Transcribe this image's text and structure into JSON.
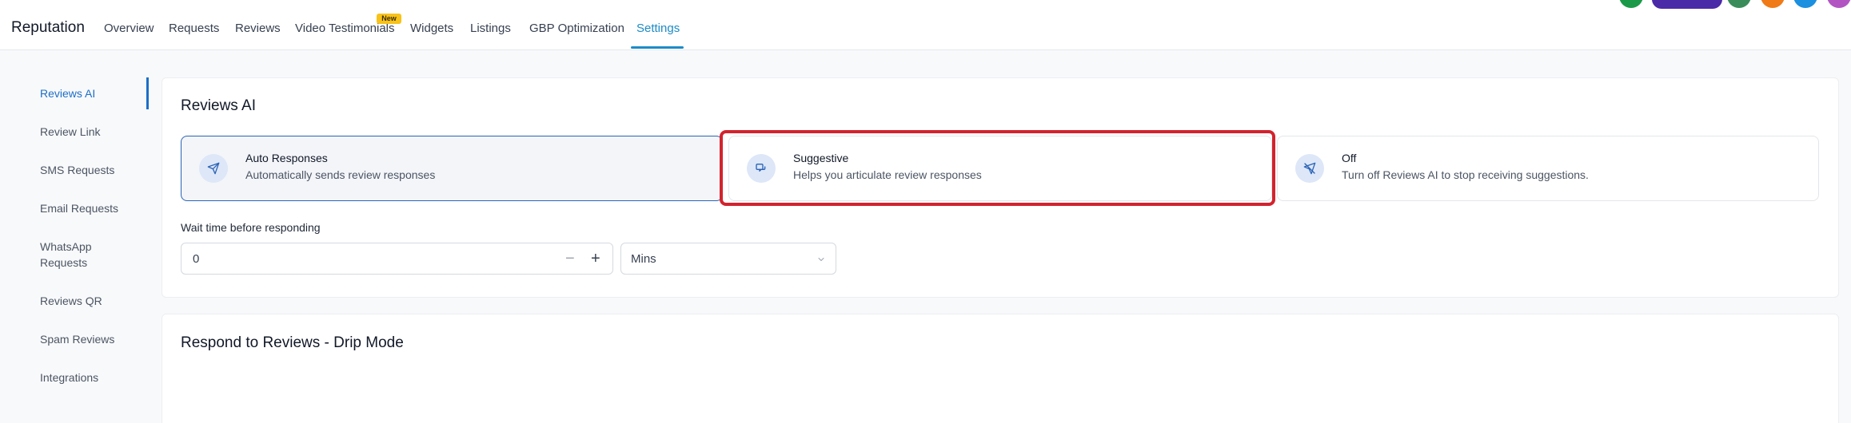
{
  "header": {
    "brand": "Reputation",
    "tabs": [
      {
        "label": "Overview"
      },
      {
        "label": "Requests"
      },
      {
        "label": "Reviews"
      },
      {
        "label": "Video Testimonials",
        "badge": "New"
      },
      {
        "label": "Widgets"
      },
      {
        "label": "Listings"
      },
      {
        "label": "GBP Optimization"
      },
      {
        "label": "Settings",
        "active": true
      }
    ],
    "right_icon_colors": [
      "#1a9a48",
      "#3a8d5b",
      "#f07a16",
      "#1b8fe0",
      "#b255c2"
    ],
    "ask_ai_color": "#4b2aa8"
  },
  "sidebar": {
    "items": [
      {
        "label": "Reviews AI",
        "active": true
      },
      {
        "label": "Review Link"
      },
      {
        "label": "SMS Requests"
      },
      {
        "label": "Email Requests"
      },
      {
        "label": "WhatsApp Requests"
      },
      {
        "label": "Reviews QR"
      },
      {
        "label": "Spam Reviews"
      },
      {
        "label": "Integrations"
      }
    ]
  },
  "reviews_ai": {
    "title": "Reviews AI",
    "options": [
      {
        "title": "Auto Responses",
        "description": "Automatically sends review responses",
        "icon": "send-icon",
        "selected": true
      },
      {
        "title": "Suggestive",
        "description": "Helps you articulate review responses",
        "icon": "chat-icon"
      },
      {
        "title": "Off",
        "description": "Turn off Reviews AI to stop receiving suggestions.",
        "icon": "send-off-icon"
      }
    ],
    "wait_label": "Wait time before responding",
    "wait_value": "0",
    "unit": "Mins",
    "minus": "−",
    "plus": "+"
  },
  "drip": {
    "title": "Respond to Reviews - Drip Mode"
  },
  "colors": {
    "accent": "#1c8bc7",
    "selected_border": "#2a63b6",
    "highlight": "#d3232e"
  }
}
